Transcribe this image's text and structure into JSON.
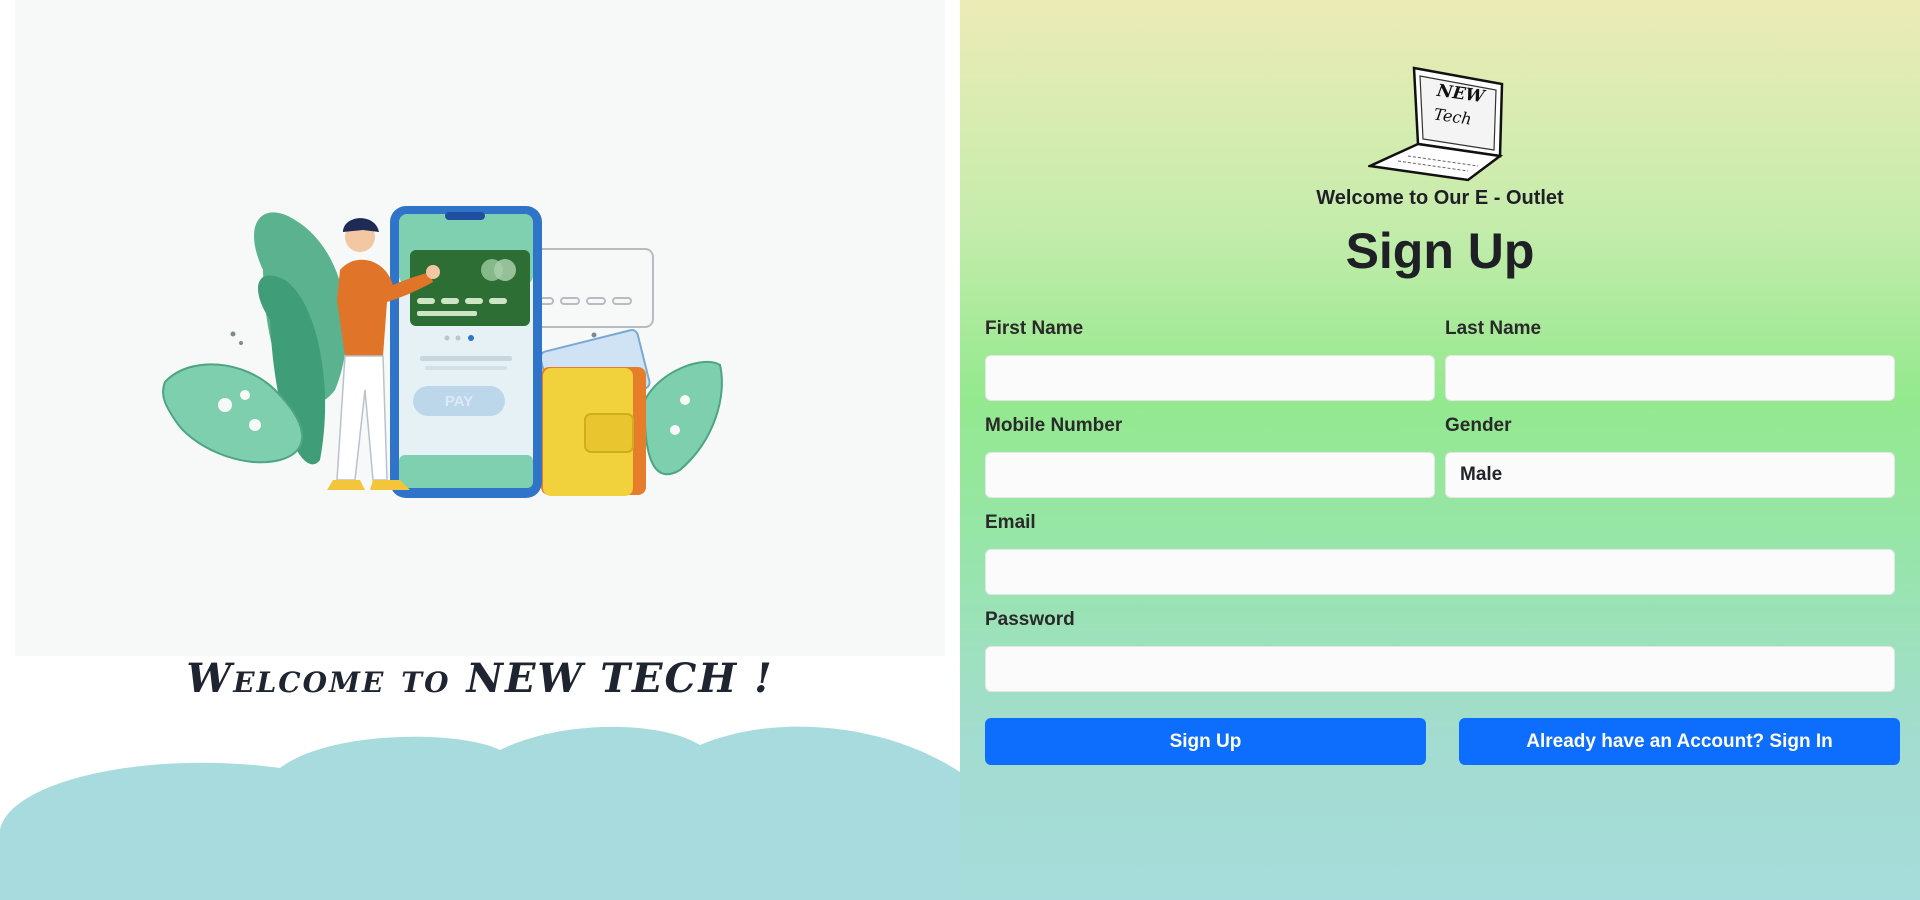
{
  "left_panel": {
    "illustration": {
      "pay_label": "PAY"
    },
    "welcome_text": "Welcome to NEW TECH !"
  },
  "right_panel": {
    "logo": {
      "line1": "NEW",
      "line2": "Tech"
    },
    "subtitle": "Welcome to Our E - Outlet",
    "title": "Sign Up",
    "form": {
      "first_name": {
        "label": "First Name",
        "value": ""
      },
      "last_name": {
        "label": "Last Name",
        "value": ""
      },
      "mobile_number": {
        "label": "Mobile Number",
        "value": ""
      },
      "gender": {
        "label": "Gender",
        "value": "Male"
      },
      "email": {
        "label": "Email",
        "value": ""
      },
      "password": {
        "label": "Password",
        "value": ""
      }
    },
    "buttons": {
      "sign_up": "Sign Up",
      "sign_in": "Already have an Account? Sign In"
    }
  },
  "colors": {
    "primary_button": "#0d6efd",
    "cloud": "#a8dbdd"
  }
}
